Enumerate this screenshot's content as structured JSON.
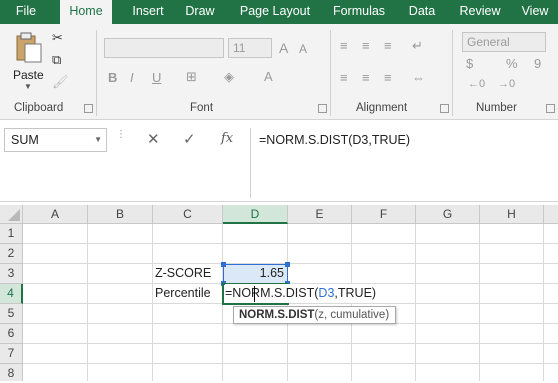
{
  "tabs": [
    "File",
    "Home",
    "Insert",
    "Draw",
    "Page Layout",
    "Formulas",
    "Data",
    "Review",
    "View"
  ],
  "active_tab": "Home",
  "ribbon": {
    "clipboard": {
      "paste_label": "Paste",
      "group_label": "Clipboard"
    },
    "font": {
      "font_size": "11",
      "bold": "B",
      "italic": "I",
      "underline": "U",
      "grow_font": "A",
      "shrink_font": "A",
      "group_label": "Font"
    },
    "alignment": {
      "group_label": "Alignment"
    },
    "number": {
      "format": "General",
      "currency": "$",
      "percent": "%",
      "comma": "9",
      "group_label": "Number"
    }
  },
  "formula_bar": {
    "name_box": "SUM",
    "cancel": "✕",
    "enter": "✓",
    "fx": "fx",
    "formula": "=NORM.S.DIST(D3,TRUE)"
  },
  "columns": [
    "A",
    "B",
    "C",
    "D",
    "E",
    "F",
    "G",
    "H"
  ],
  "selected_column": "D",
  "rows": [
    "1",
    "2",
    "3",
    "4",
    "5",
    "6",
    "7",
    "8"
  ],
  "selected_row": "4",
  "cells": {
    "C3": "Z-SCORE",
    "D3": "1.65",
    "C4": "Percentile",
    "D4_prefix": "=NORM.S.DIST(",
    "D4_ref": "D3",
    "D4_suffix": ",TRUE)"
  },
  "tooltip": {
    "func_name": "NORM.S.DIST",
    "args": "(z, cumulative)"
  },
  "colors": {
    "accent": "#217346",
    "ref_blue": "#2f6fd1"
  }
}
